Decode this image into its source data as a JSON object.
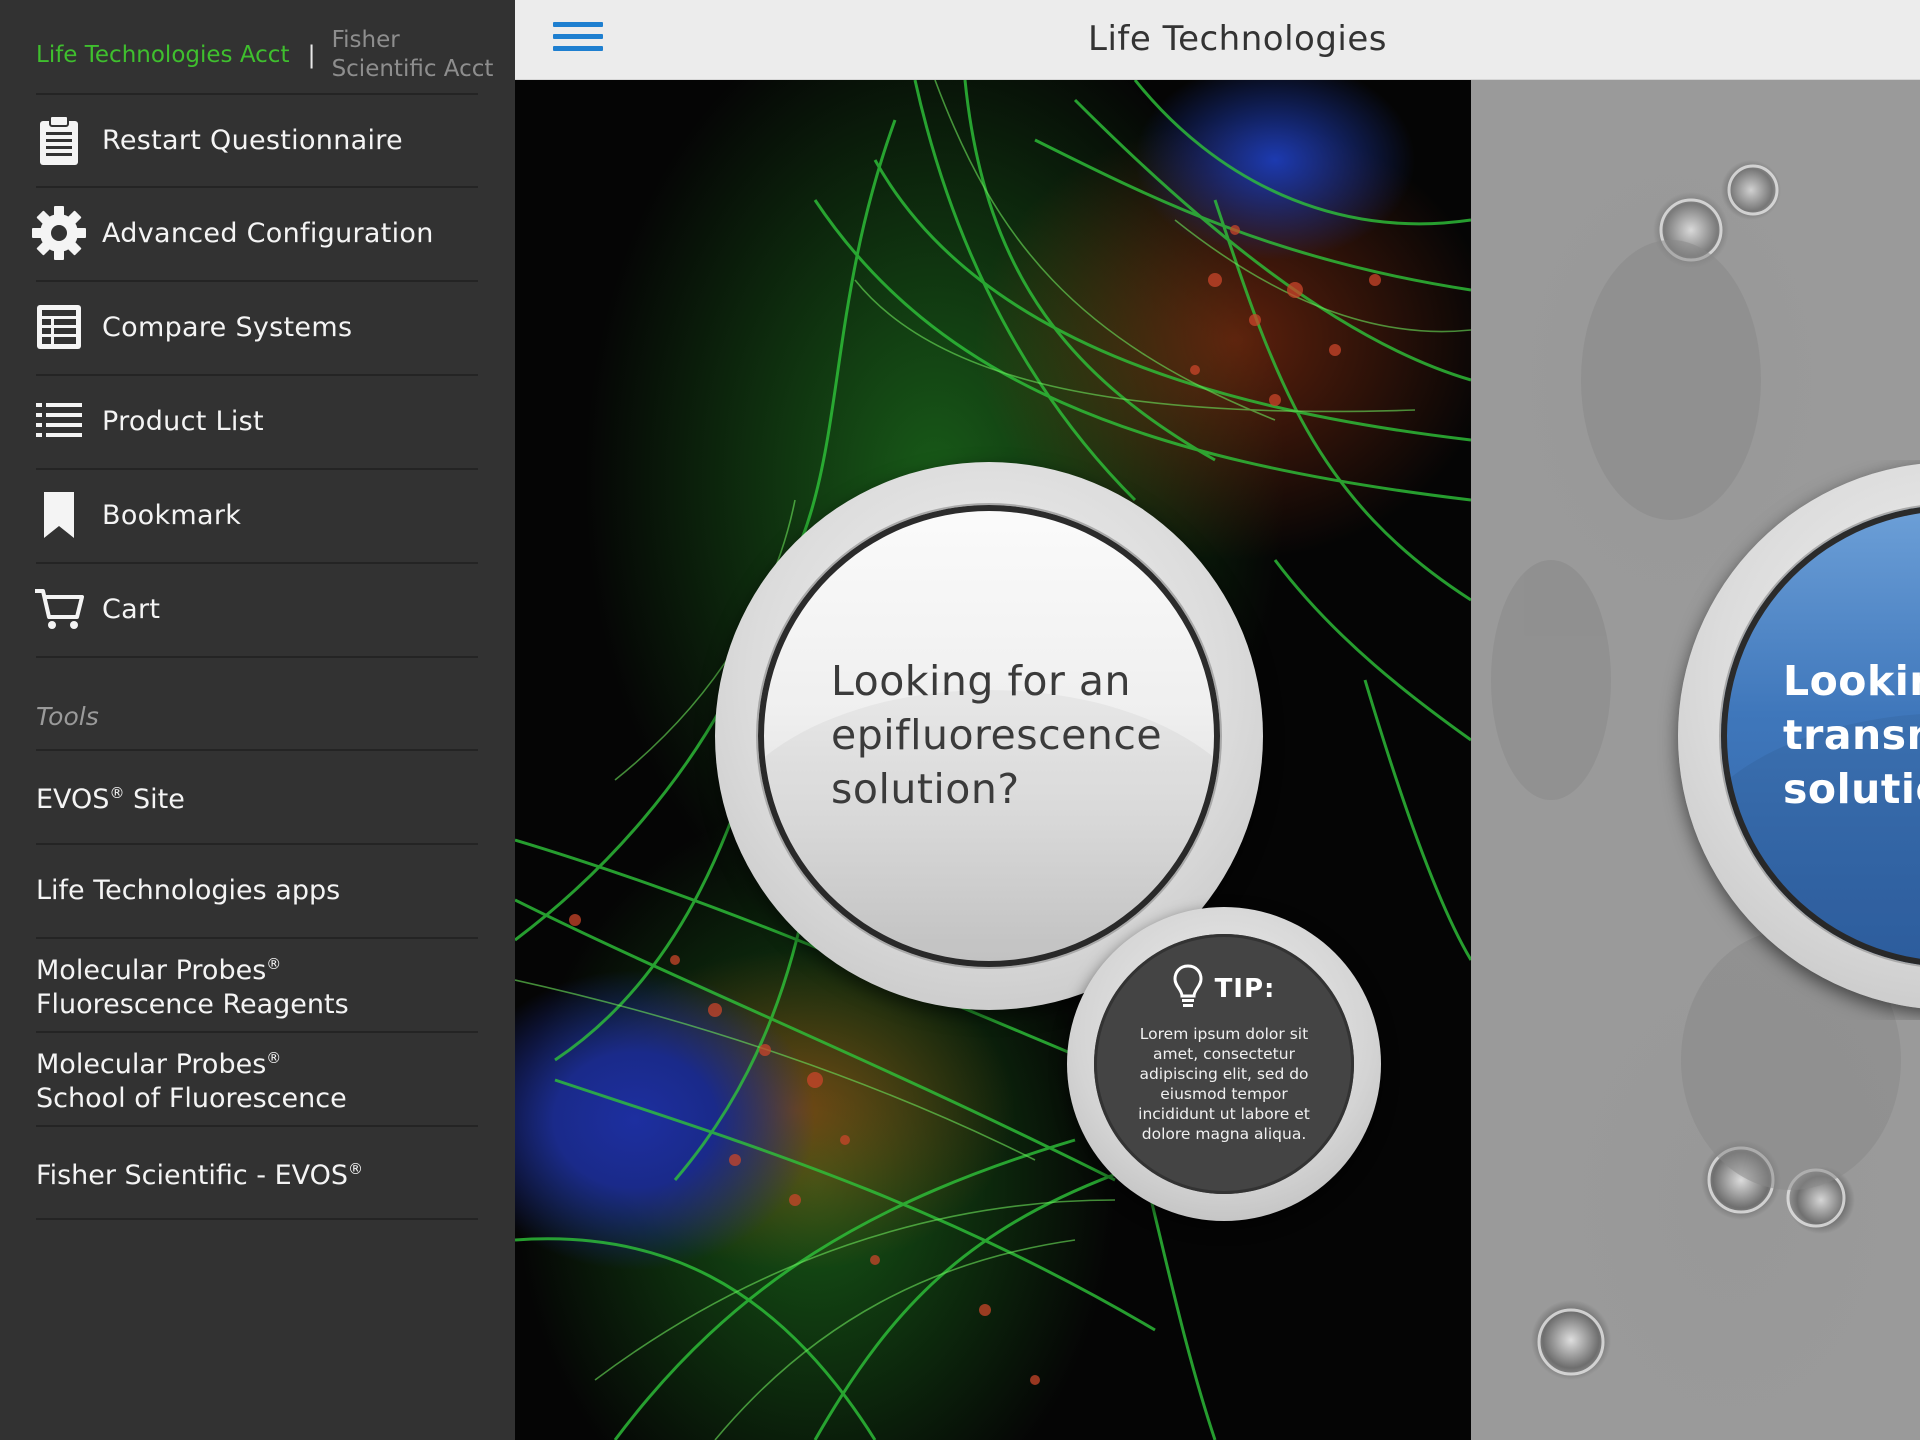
{
  "accounts": {
    "active": "Life Technologies Acct",
    "separator": "|",
    "other": "Fisher Scientific Acct"
  },
  "menu": [
    {
      "label": "Restart Questionnaire",
      "icon": "clipboard-icon"
    },
    {
      "label": "Advanced Configuration",
      "icon": "gear-icon"
    },
    {
      "label": "Compare Systems",
      "icon": "table-icon"
    },
    {
      "label": "Product List",
      "icon": "list-icon"
    },
    {
      "label": "Bookmark",
      "icon": "bookmark-icon"
    },
    {
      "label": "Cart",
      "icon": "cart-icon"
    }
  ],
  "tools": {
    "heading": "Tools",
    "items": [
      {
        "label": "EVOS",
        "reg": "®",
        "suffix": " Site"
      },
      {
        "label": "Life Technologies apps"
      },
      {
        "line1": "Molecular Probes",
        "reg": "®",
        "line2": "Fluorescence Reagents"
      },
      {
        "line1": "Molecular Probes",
        "reg": "®",
        "line2": "School of Fluorescence"
      },
      {
        "label": "Fisher Scientific - EVOS",
        "reg": "®"
      }
    ]
  },
  "header": {
    "title": "Life Technologies",
    "menu_icon": "hamburger-icon",
    "accent_color": "#1e7fd0"
  },
  "panels": {
    "epifluorescence": {
      "question_lines": [
        "Looking for an",
        "epifluorescence",
        "solution?"
      ]
    },
    "transmitted": {
      "question_lines": [
        "Lookin",
        "transm",
        "solutio"
      ]
    }
  },
  "tip": {
    "icon": "lightbulb-icon",
    "title": "TIP:",
    "body": "Lorem ipsum dolor sit amet, consectetur adipiscing elit, sed do eiusmod tempor incididunt ut labore et dolore magna aliqua."
  },
  "colors": {
    "active_account": "#3fbf2e",
    "sidebar_bg": "#323232",
    "header_bg": "#ececec"
  }
}
